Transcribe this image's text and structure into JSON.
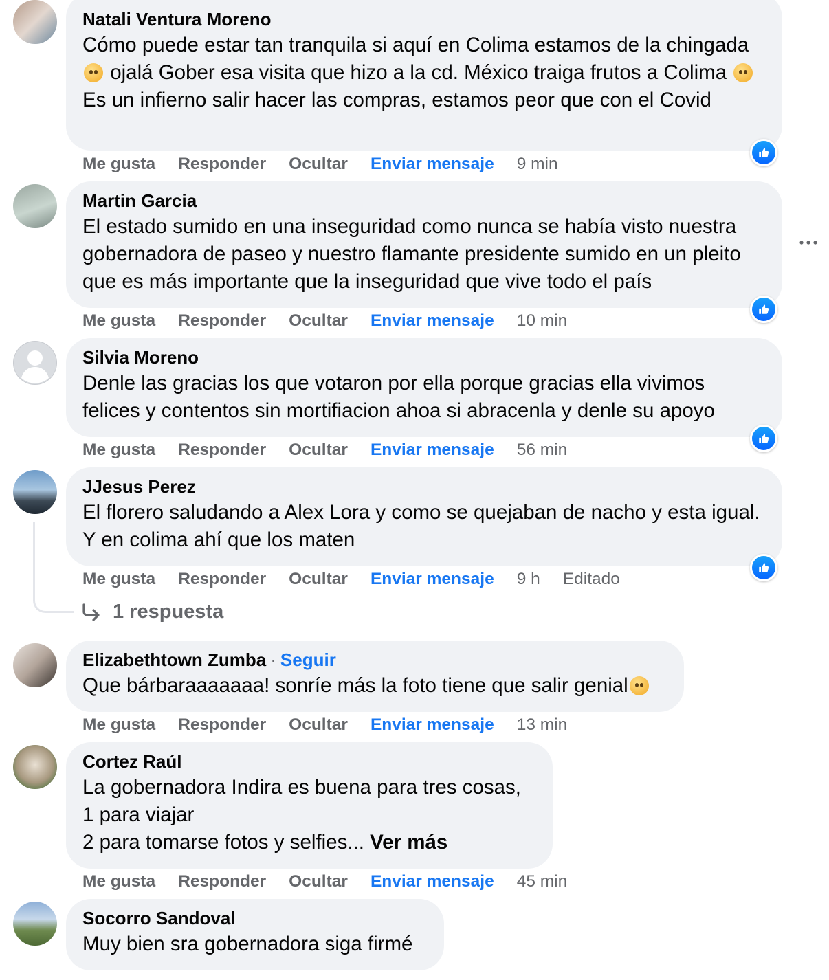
{
  "colors": {
    "accent": "#1877f2",
    "bubble": "#f0f2f5",
    "muted": "#65676b"
  },
  "action_labels": {
    "like": "Me gusta",
    "reply": "Responder",
    "hide": "Ocultar",
    "send": "Enviar mensaje"
  },
  "comments": [
    {
      "author": "Natali Ventura Moreno",
      "text_parts": [
        "Cómo puede estar tan tranquila si aquí en Colima estamos de la chingada",
        "ojalá Gober esa visita que hizo a la cd. México traiga frutos a Colima",
        "Es un infierno salir hacer las compras, estamos peor que con el Covid"
      ],
      "time": "9 min",
      "avatar_icon": "avatar-photo"
    },
    {
      "author": "Martin Garcia",
      "text": "El estado sumido en una inseguridad como nunca se había visto nuestra gobernadora de paseo y nuestro flamante presidente sumido en un pleito que es más importante que la inseguridad que vive todo el país",
      "time": "10 min",
      "avatar_icon": "avatar-photo"
    },
    {
      "author": "Silvia Moreno",
      "text": "Denle las gracias los que votaron por ella porque gracias ella vivimos felices y contentos sin mortifiacion ahoa si abracenla y denle su apoyo",
      "time": "56 min",
      "avatar_icon": "default-avatar-icon"
    },
    {
      "author": "JJesus Perez",
      "text": "El florero saludando a Alex Lora y como se quejaban de nacho y esta igual. Y en colima ahí que los maten",
      "time": "9 h",
      "edited": "Editado",
      "replies": "1 respuesta",
      "avatar_icon": "avatar-photo"
    },
    {
      "author": "Elizabethtown Zumba",
      "follow": "Seguir",
      "text": "Que bárbaraaaaaaa! sonríe más la foto tiene que salir genial",
      "time": "13 min",
      "avatar_icon": "avatar-photo"
    },
    {
      "author": "Cortez Raúl",
      "text_lines": [
        "La gobernadora Indira es buena para tres cosas,",
        "1 para viajar",
        "2 para tomarse fotos y selfies..."
      ],
      "see_more": "Ver más",
      "time": "45 min",
      "avatar_icon": "avatar-photo"
    },
    {
      "author": "Socorro Sandoval",
      "text": "Muy bien sra gobernadora siga firmé",
      "avatar_icon": "avatar-photo"
    }
  ]
}
